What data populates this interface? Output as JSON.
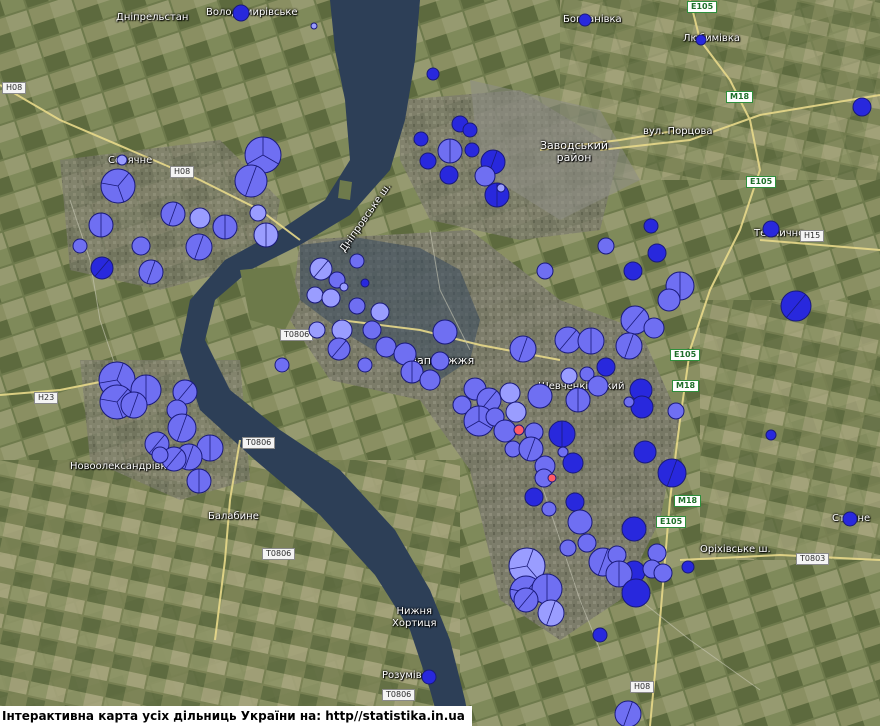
{
  "colors": {
    "marker_light": "#9a9dff",
    "marker_mid": "#6f6ff2",
    "marker_dark": "#2828dd",
    "marker_red": "#ff5a66",
    "river": "#2d3f57",
    "road": "#e8d98a"
  },
  "places": [
    {
      "id": "dniprelstan",
      "label": "Дніпрельстан"
    },
    {
      "id": "volodymyrivske",
      "label": "Володимирівське"
    },
    {
      "id": "bohdanivka",
      "label": "Богданівка"
    },
    {
      "id": "lyubimivka",
      "label": "Любимівка"
    },
    {
      "id": "sonyachne",
      "label": "Сонячне"
    },
    {
      "id": "zavodskyi",
      "label": "Заводський район",
      "lines": [
        "Заводський",
        "район"
      ]
    },
    {
      "id": "vul-portsova",
      "label": "вул. Порцова"
    },
    {
      "id": "teplychne",
      "label": "Тепличне"
    },
    {
      "id": "dniprovske-sh",
      "label": "Дніпровське ш."
    },
    {
      "id": "zaporizhzhia",
      "label": "Запоріжжя"
    },
    {
      "id": "shevchenkivskyi",
      "label": "Шевченківський"
    },
    {
      "id": "novooleksandrivka",
      "label": "Новоолександрівка"
    },
    {
      "id": "balabyne",
      "label": "Балабине"
    },
    {
      "id": "nyzhnia-khortytsia",
      "label": "Нижня Хортиця",
      "lines": [
        "Нижня",
        "Хортиця"
      ]
    },
    {
      "id": "rozumivka",
      "label": "Розумівка"
    },
    {
      "id": "vul-horikhivske",
      "label": "Оріхівське ш."
    },
    {
      "id": "stepne",
      "label": "Степне"
    }
  ],
  "roads": [
    {
      "id": "h08-nw",
      "label": "H08"
    },
    {
      "id": "h08-top",
      "label": "H08"
    },
    {
      "id": "h08-south",
      "label": "H08"
    },
    {
      "id": "h23",
      "label": "H23"
    },
    {
      "id": "t0806-a",
      "label": "T0806"
    },
    {
      "id": "t0806-b",
      "label": "T0806"
    },
    {
      "id": "t0806-c",
      "label": "T0806"
    },
    {
      "id": "t0806-d",
      "label": "T0806"
    },
    {
      "id": "t0803",
      "label": "T0803"
    },
    {
      "id": "h15",
      "label": "H15"
    },
    {
      "id": "m18-a",
      "label": "M18"
    },
    {
      "id": "m18-b",
      "label": "M18"
    },
    {
      "id": "m18-c",
      "label": "M18"
    },
    {
      "id": "e105-a",
      "label": "E105"
    },
    {
      "id": "e105-b",
      "label": "E105"
    },
    {
      "id": "e105-c",
      "label": "E105"
    },
    {
      "id": "e105-d",
      "label": "E105"
    }
  ],
  "credit": "Інтерактивна карта усіх дільниць України на: http//statistika.in.ua"
}
